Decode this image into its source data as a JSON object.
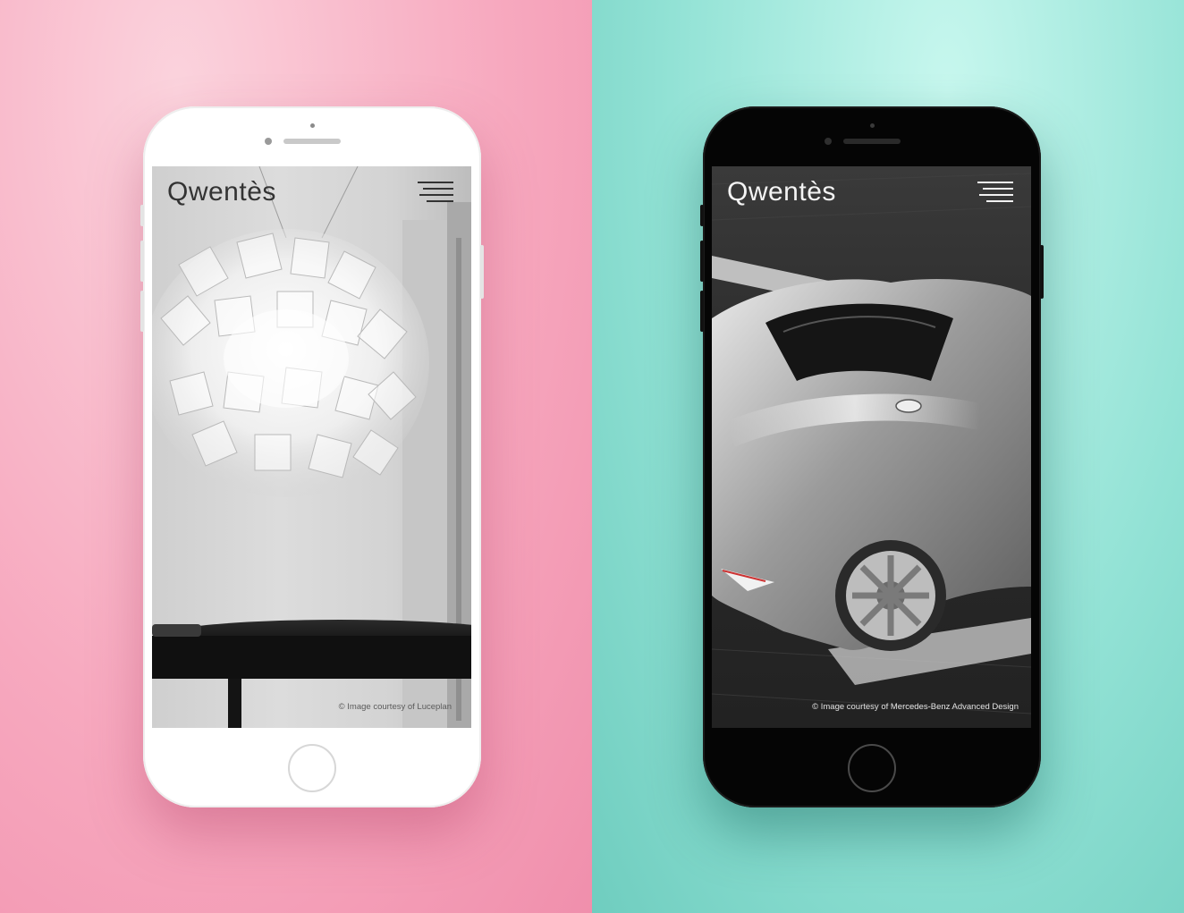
{
  "colors": {
    "left_background": "#f7a9bf",
    "right_background": "#92e2d5",
    "white_phone_body": "#ffffff",
    "black_phone_body": "#050505"
  },
  "devices": [
    {
      "variant": "white",
      "screen": {
        "brand": "Qwentès",
        "menu_icon": "hamburger-menu-icon",
        "photo": "crystal-chandelier-over-black-table",
        "credit": "© Image courtesy of Luceplan"
      }
    },
    {
      "variant": "black",
      "screen": {
        "brand": "Qwentès",
        "menu_icon": "hamburger-menu-icon",
        "photo": "silver-concept-sports-car",
        "credit": "© Image courtesy of Mercedes-Benz Advanced Design"
      }
    }
  ]
}
